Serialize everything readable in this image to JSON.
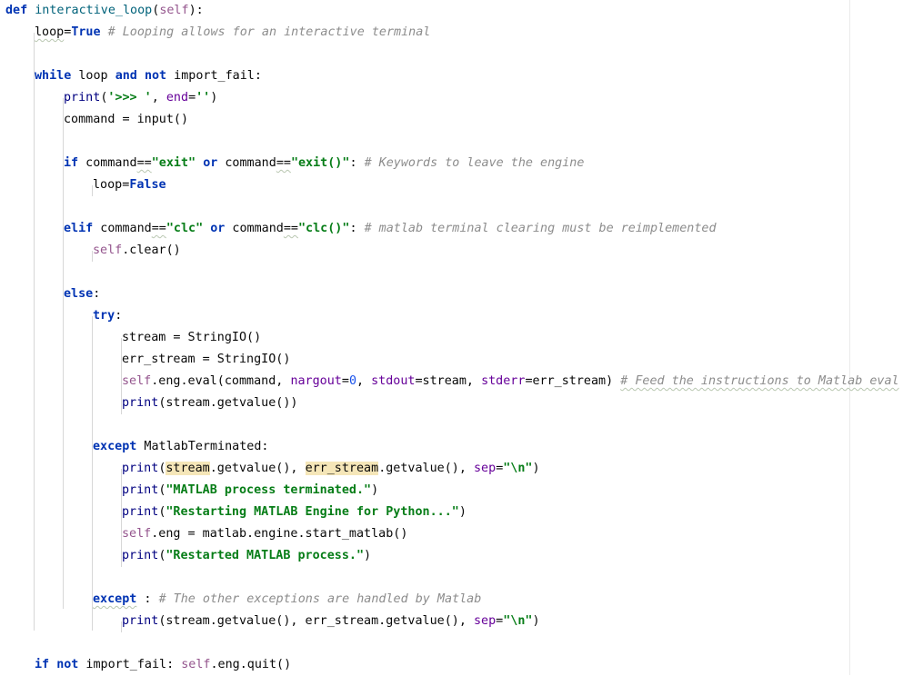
{
  "code": {
    "l1": {
      "kw": "def",
      "name": "interactive_loop",
      "open": "(",
      "self": "self",
      "close": "):"
    },
    "l2": {
      "var": "loop",
      "eq": "=",
      "val": "True",
      "comment": "# Looping allows for an interactive terminal"
    },
    "l4": {
      "kw1": "while",
      "t1": " loop ",
      "kw2": "and",
      "sp": " ",
      "kw3": "not",
      "t2": " import_fail:"
    },
    "l5": {
      "fn": "print",
      "open": "(",
      "s1": "'>>> '",
      "comma": ", ",
      "kwarg": "end",
      "eq": "=",
      "s2": "''",
      "close": ")"
    },
    "l6": {
      "text": "command = input()"
    },
    "l8": {
      "kw": "if",
      "t1": " command",
      "op1": "==",
      "s1": "\"exit\"",
      "sp": " ",
      "kw2": "or",
      "t2": " command",
      "op2": "==",
      "s2": "\"exit()\"",
      "t3": ": ",
      "comment": "# Keywords to leave the engine"
    },
    "l9": {
      "var": "loop",
      "eq": "=",
      "val": "False"
    },
    "l11": {
      "kw": "elif",
      "t1": " command",
      "op1": "==",
      "s1": "\"clc\"",
      "sp": " ",
      "kw2": "or",
      "t2": " command",
      "op2": "==",
      "s2": "\"clc()\"",
      "t3": ": ",
      "comment": "# matlab terminal clearing must be reimplemented"
    },
    "l12": {
      "self": "self",
      "rest": ".clear()"
    },
    "l14": {
      "kw": "else",
      "rest": ":"
    },
    "l15": {
      "kw": "try",
      "rest": ":"
    },
    "l16": {
      "text": "stream = StringIO()"
    },
    "l17": {
      "text": "err_stream = StringIO()"
    },
    "l18": {
      "self": "self",
      "t1": ".eng.eval(command, ",
      "k1": "nargout",
      "eq1": "=",
      "n1": "0",
      "t2": ", ",
      "k2": "stdout",
      "t3": "=stream, ",
      "k3": "stderr",
      "t4": "=err_stream) ",
      "comment": "# Feed the instructions to Matlab eval"
    },
    "l19": {
      "fn": "print",
      "rest": "(stream.getvalue())"
    },
    "l21": {
      "kw": "except",
      "rest": " MatlabTerminated:"
    },
    "l22": {
      "fn": "print",
      "open": "(",
      "h1": "stream",
      "t1": ".getvalue(), ",
      "h2": "err_stream",
      "t2": ".getvalue(), ",
      "kwarg": "sep",
      "eq": "=",
      "s": "\"\\n\"",
      "close": ")"
    },
    "l23": {
      "fn": "print",
      "open": "(",
      "s": "\"MATLAB process terminated.\"",
      "close": ")"
    },
    "l24": {
      "fn": "print",
      "open": "(",
      "s": "\"Restarting MATLAB Engine for Python...\"",
      "close": ")"
    },
    "l25": {
      "self": "self",
      "rest": ".eng = matlab.engine.start_matlab()"
    },
    "l26": {
      "fn": "print",
      "open": "(",
      "s": "\"Restarted MATLAB process.\"",
      "close": ")"
    },
    "l28": {
      "kw": "except",
      "t1": " : ",
      "comment": "# The other exceptions are handled by Matlab"
    },
    "l29": {
      "fn": "print",
      "t1": "(stream.getvalue(), err_stream.getvalue(), ",
      "kwarg": "sep",
      "eq": "=",
      "s": "\"\\n\"",
      "close": ")"
    },
    "l31": {
      "kw1": "if",
      "sp": " ",
      "kw2": "not",
      "t1": " import_fail: ",
      "self": "self",
      "rest": ".eng.quit()"
    }
  },
  "colors": {
    "keyword": "#0033b3",
    "string": "#067d17",
    "comment": "#8c8c8c",
    "self": "#94558d",
    "kwarg": "#660099",
    "number": "#1750eb",
    "highlight": "#f5e6b8"
  }
}
